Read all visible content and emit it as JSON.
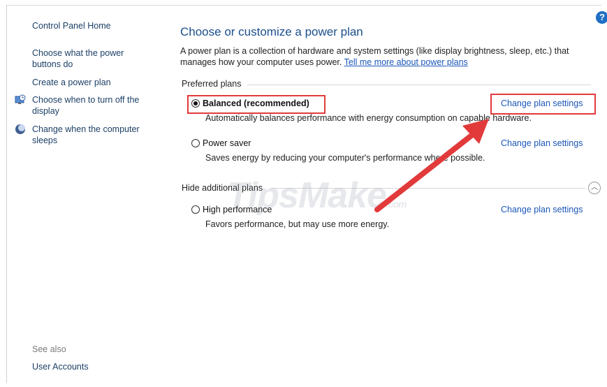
{
  "help_glyph": "?",
  "sidebar": {
    "home": "Control Panel Home",
    "items": [
      {
        "label": "Choose what the power buttons do",
        "icon": ""
      },
      {
        "label": "Create a power plan",
        "icon": ""
      },
      {
        "label": "Choose when to turn off the display",
        "icon": "display-clock-icon"
      },
      {
        "label": "Change when the computer sleeps",
        "icon": "moon-sleep-icon"
      }
    ],
    "see_also": "See also",
    "see_also_items": [
      {
        "label": "User Accounts"
      }
    ]
  },
  "main": {
    "title": "Choose or customize a power plan",
    "description": "A power plan is a collection of hardware and system settings (like display brightness, sleep, etc.) that manages how your computer uses power.",
    "learn_more": "Tell me more about power plans",
    "preferred_heading": "Preferred plans",
    "additional_heading": "Hide additional plans",
    "change_label": "Change plan settings",
    "plans": [
      {
        "name": "Balanced (recommended)",
        "selected": true,
        "description": "Automatically balances performance with energy consumption on capable hardware."
      },
      {
        "name": "Power saver",
        "selected": false,
        "description": "Saves energy by reducing your computer's performance where possible."
      },
      {
        "name": "High performance",
        "selected": false,
        "description": "Favors performance, but may use more energy."
      }
    ]
  },
  "watermark": {
    "brand": "TipsMake",
    "suffix": ".com"
  },
  "colors": {
    "link": "#1a56b8",
    "title": "#1b4f8c",
    "highlight": "#e23a3a"
  }
}
